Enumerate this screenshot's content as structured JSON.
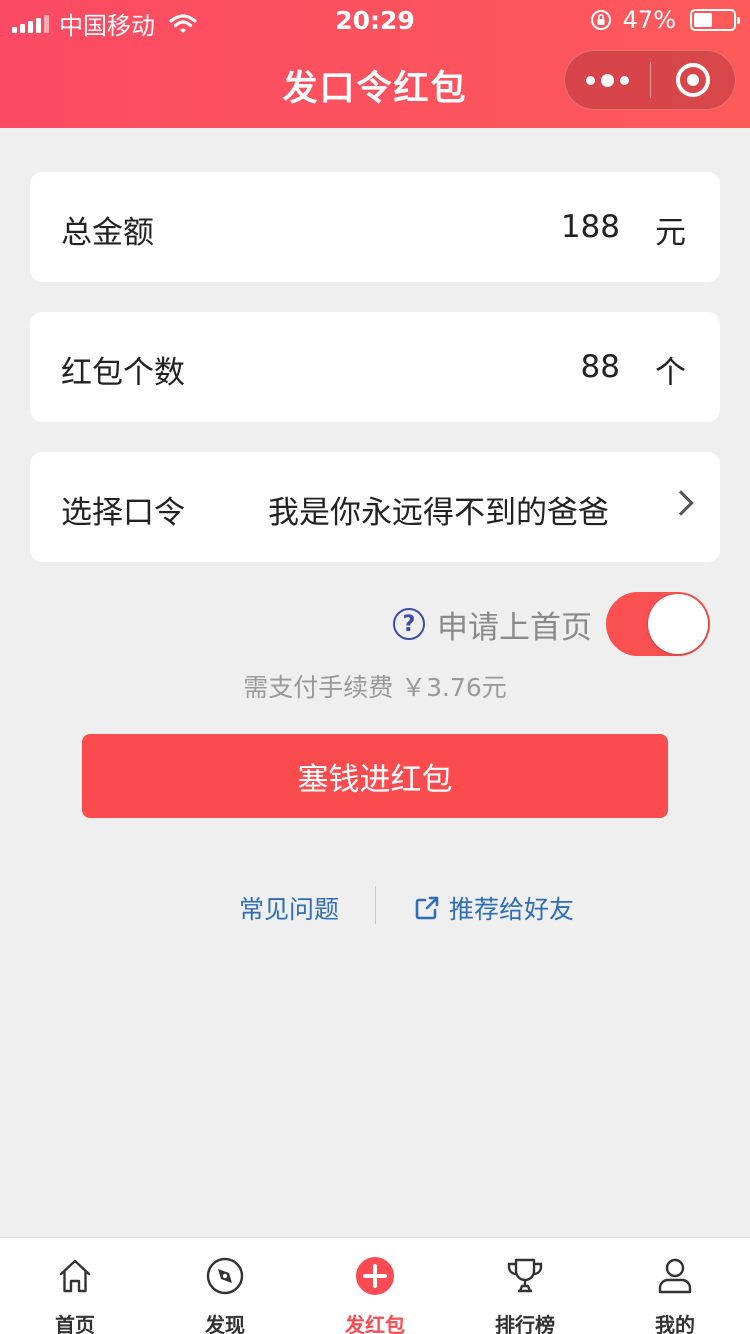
{
  "status_bar": {
    "carrier": "中国移动",
    "time": "20:29",
    "battery": "47%",
    "battery_level": 0.47
  },
  "nav": {
    "title": "发口令红包"
  },
  "form": {
    "amount": {
      "label": "总金额",
      "value": "188",
      "unit": "元"
    },
    "count": {
      "label": "红包个数",
      "value": "88",
      "unit": "个"
    },
    "command": {
      "label": "选择口令",
      "value": "我是你永远得不到的爸爸"
    }
  },
  "apply_home": {
    "help_icon": "?",
    "label": "申请上首页",
    "enabled": true
  },
  "fee_text": "需支付手续费 ￥3.76元",
  "submit_label": "塞钱进红包",
  "links": {
    "faq": "常见问题",
    "share": "推荐给好友"
  },
  "tabs": [
    {
      "label": "首页",
      "icon": "home-icon"
    },
    {
      "label": "发现",
      "icon": "compass-icon"
    },
    {
      "label": "发红包",
      "icon": "plus-circle-icon",
      "active": true
    },
    {
      "label": "排行榜",
      "icon": "trophy-icon"
    },
    {
      "label": "我的",
      "icon": "user-icon"
    }
  ],
  "colors": {
    "accent": "#fa4b4f",
    "link": "#2f6db5",
    "background": "#efefef"
  }
}
